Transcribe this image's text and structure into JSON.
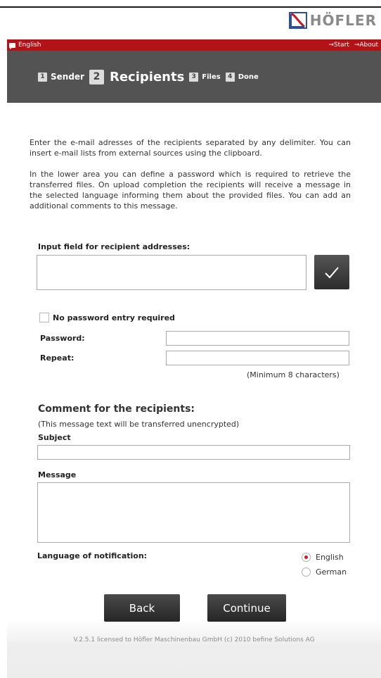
{
  "brand": {
    "name": "HÖFLER"
  },
  "topbar": {
    "language": "English",
    "start_link": "→Start",
    "about_link": "→About"
  },
  "steps": [
    {
      "num": "1",
      "label": "Sender"
    },
    {
      "num": "2",
      "label": "Recipients"
    },
    {
      "num": "3",
      "label": "Files"
    },
    {
      "num": "4",
      "label": "Done"
    }
  ],
  "intro": {
    "paragraph1": "Enter the e-mail adresses of the recipients separated by any delimiter. You can insert e-mail lists from external sources using the clipboard.",
    "paragraph2": "In the lower area you can define a password which is required to retrieve the transferred files. On upload completion the recipients will receive a message in the selected language informing them about the provided files. You can add an additional comments to this message."
  },
  "recipients": {
    "label": "Input field for recipient addresses:",
    "value": ""
  },
  "password": {
    "no_password_label": "No password entry required",
    "no_password_checked": false,
    "password_label": "Password:",
    "repeat_label": "Repeat:",
    "hint": "(Minimum 8 characters)"
  },
  "comment": {
    "heading": "Comment for the recipients:",
    "note": "(This message text will be transferred unencrypted)",
    "subject_label": "Subject",
    "subject_value": "",
    "message_label": "Message",
    "message_value": ""
  },
  "language": {
    "label": "Language of notification:",
    "options": [
      "English",
      "German"
    ],
    "selected": "English"
  },
  "buttons": {
    "back": "Back",
    "continue": "Continue"
  },
  "footer": {
    "text": "V.2.5.1 licensed to Höfler Maschinenbau GmbH (c) 2010 befine Solutions AG"
  },
  "colors": {
    "brand_red": "#b31217",
    "step_bar": "#535353",
    "button_dark": "#2c2c2c",
    "radio_selected": "#d81b1b"
  }
}
